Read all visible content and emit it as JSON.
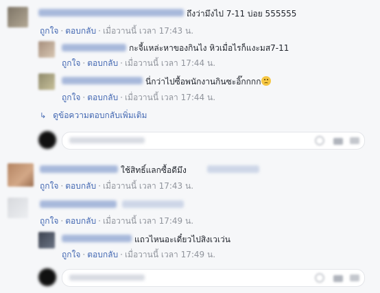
{
  "actions": {
    "like": "ถูกใจ",
    "reply": "ตอบกลับ",
    "sep": "·"
  },
  "comments": [
    {
      "text": "ถึงว่ามึงไป 7-11 บ่อย 555555",
      "time": "เมื่อวานนี้ เวลา 17:43 น."
    },
    {
      "text": "กะจี้แหล่ะหาของกินไง หิวเมื่อไรก็แงะมส7-11",
      "time": "เมื่อวานนี้ เวลา 17:44 น."
    },
    {
      "text": "นี่กว่าไปซื้อพนักงานกินซะอิ๊กกกก",
      "time": "เมื่อวานนี้ เวลา 17:44 น."
    },
    {
      "text": "ใช้สิทธิ์แลกซื้อดีมึง",
      "time": "เมื่อวานนี้ เวลา 17:43 น."
    },
    {
      "text": "",
      "time": "เมื่อวานนี้ เวลา 17:49 น."
    },
    {
      "text": "แถวไหนอะเดี๋ยวไปสิงเวเว่น",
      "time": "เมื่อวานนี้ เวลา 17:49 น."
    }
  ],
  "more_replies": "ดูข้อความตอบกลับเพิ่มเติม",
  "colors": {
    "background": "#f6f7f9",
    "link": "#4267b2",
    "meta": "#90949c",
    "text": "#1d2129"
  }
}
